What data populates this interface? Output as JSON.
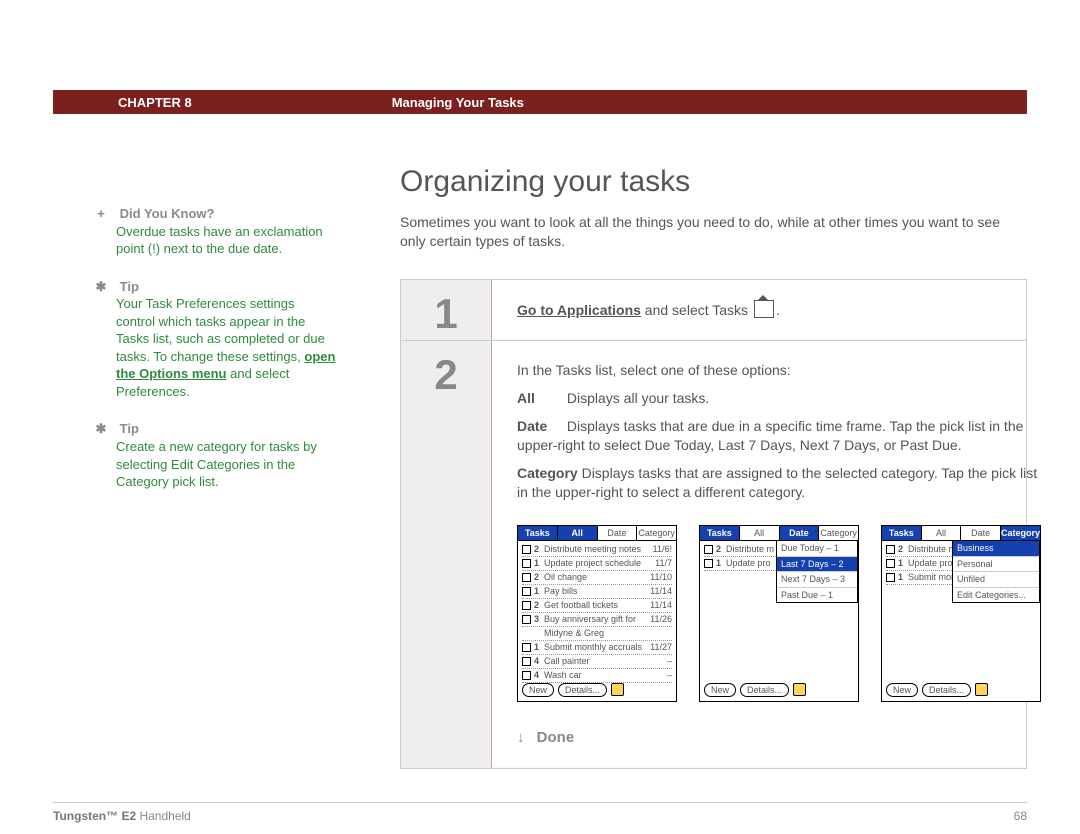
{
  "header": {
    "chapter": "CHAPTER 8",
    "title": "Managing Your Tasks"
  },
  "page_title": "Organizing your tasks",
  "intro": "Sometimes you want to look at all the things you need to do, while at other times you want to see only certain types of tasks.",
  "sidebar": {
    "didyouknow": {
      "heading": "Did You Know?",
      "text": "Overdue tasks have an exclamation point (!) next to the due date."
    },
    "tip1": {
      "heading": "Tip",
      "pre": "Your Task Preferences settings control which tasks appear in the Tasks list, such as completed or due tasks. To change these settings, ",
      "link": "open the Options menu",
      "post": " and select Preferences."
    },
    "tip2": {
      "heading": "Tip",
      "text": "Create a new category for tasks by selecting Edit Categories in the Category pick list."
    }
  },
  "step1": {
    "lead": "Go to Applications",
    "rest": " and select Tasks "
  },
  "step2": {
    "intro": "In the Tasks list, select one of these options:",
    "defs": [
      {
        "term": "All",
        "text": "Displays all your tasks."
      },
      {
        "term": "Date",
        "text": "Displays tasks that are due in a specific time frame. Tap the pick list in the upper-right to select Due Today, Last 7 Days, Next 7 Days, or Past Due."
      },
      {
        "term": "Category",
        "text": "Displays tasks that are assigned to the selected category. Tap the pick list in the upper-right to select a different category."
      }
    ]
  },
  "palm_tabs": [
    "Tasks",
    "All",
    "Date",
    "Category"
  ],
  "palm1_rows": [
    {
      "p": "2",
      "n": "Distribute meeting notes",
      "d": "11/6!"
    },
    {
      "p": "1",
      "n": "Update project schedule",
      "d": "11/7"
    },
    {
      "p": "2",
      "n": "Oil change",
      "d": "11/10"
    },
    {
      "p": "1",
      "n": "Pay bills",
      "d": "11/14"
    },
    {
      "p": "2",
      "n": "Get football tickets",
      "d": "11/14"
    },
    {
      "p": "3",
      "n": "Buy anniversary gift for",
      "d": "11/26"
    },
    {
      "p": "",
      "n": "Midyne & Greg",
      "d": ""
    },
    {
      "p": "1",
      "n": "Submit monthly accruals",
      "d": "11/27"
    },
    {
      "p": "4",
      "n": "Call painter",
      "d": "–"
    },
    {
      "p": "4",
      "n": "Wash car",
      "d": "–"
    }
  ],
  "palm2_rows": [
    {
      "p": "2",
      "n": "Distribute m",
      "d": ""
    },
    {
      "p": "1",
      "n": "Update pro",
      "d": ""
    }
  ],
  "palm2_drop": [
    "Due Today – 1",
    "Last 7 Days – 2",
    "Next 7 Days – 3",
    "Past Due – 1"
  ],
  "palm3_rows": [
    {
      "p": "2",
      "n": "Distribute mee",
      "d": ""
    },
    {
      "p": "1",
      "n": "Update projec",
      "d": ""
    },
    {
      "p": "1",
      "n": "Submit monthl",
      "d": ""
    }
  ],
  "palm3_drop": [
    "Business",
    "Personal",
    "Unfiled",
    "Edit Categories..."
  ],
  "palm_buttons": {
    "new": "New",
    "details": "Details..."
  },
  "done": "Done",
  "footer": {
    "product_bold": "Tungsten™ E2",
    "product_rest": " Handheld",
    "page": "68"
  }
}
